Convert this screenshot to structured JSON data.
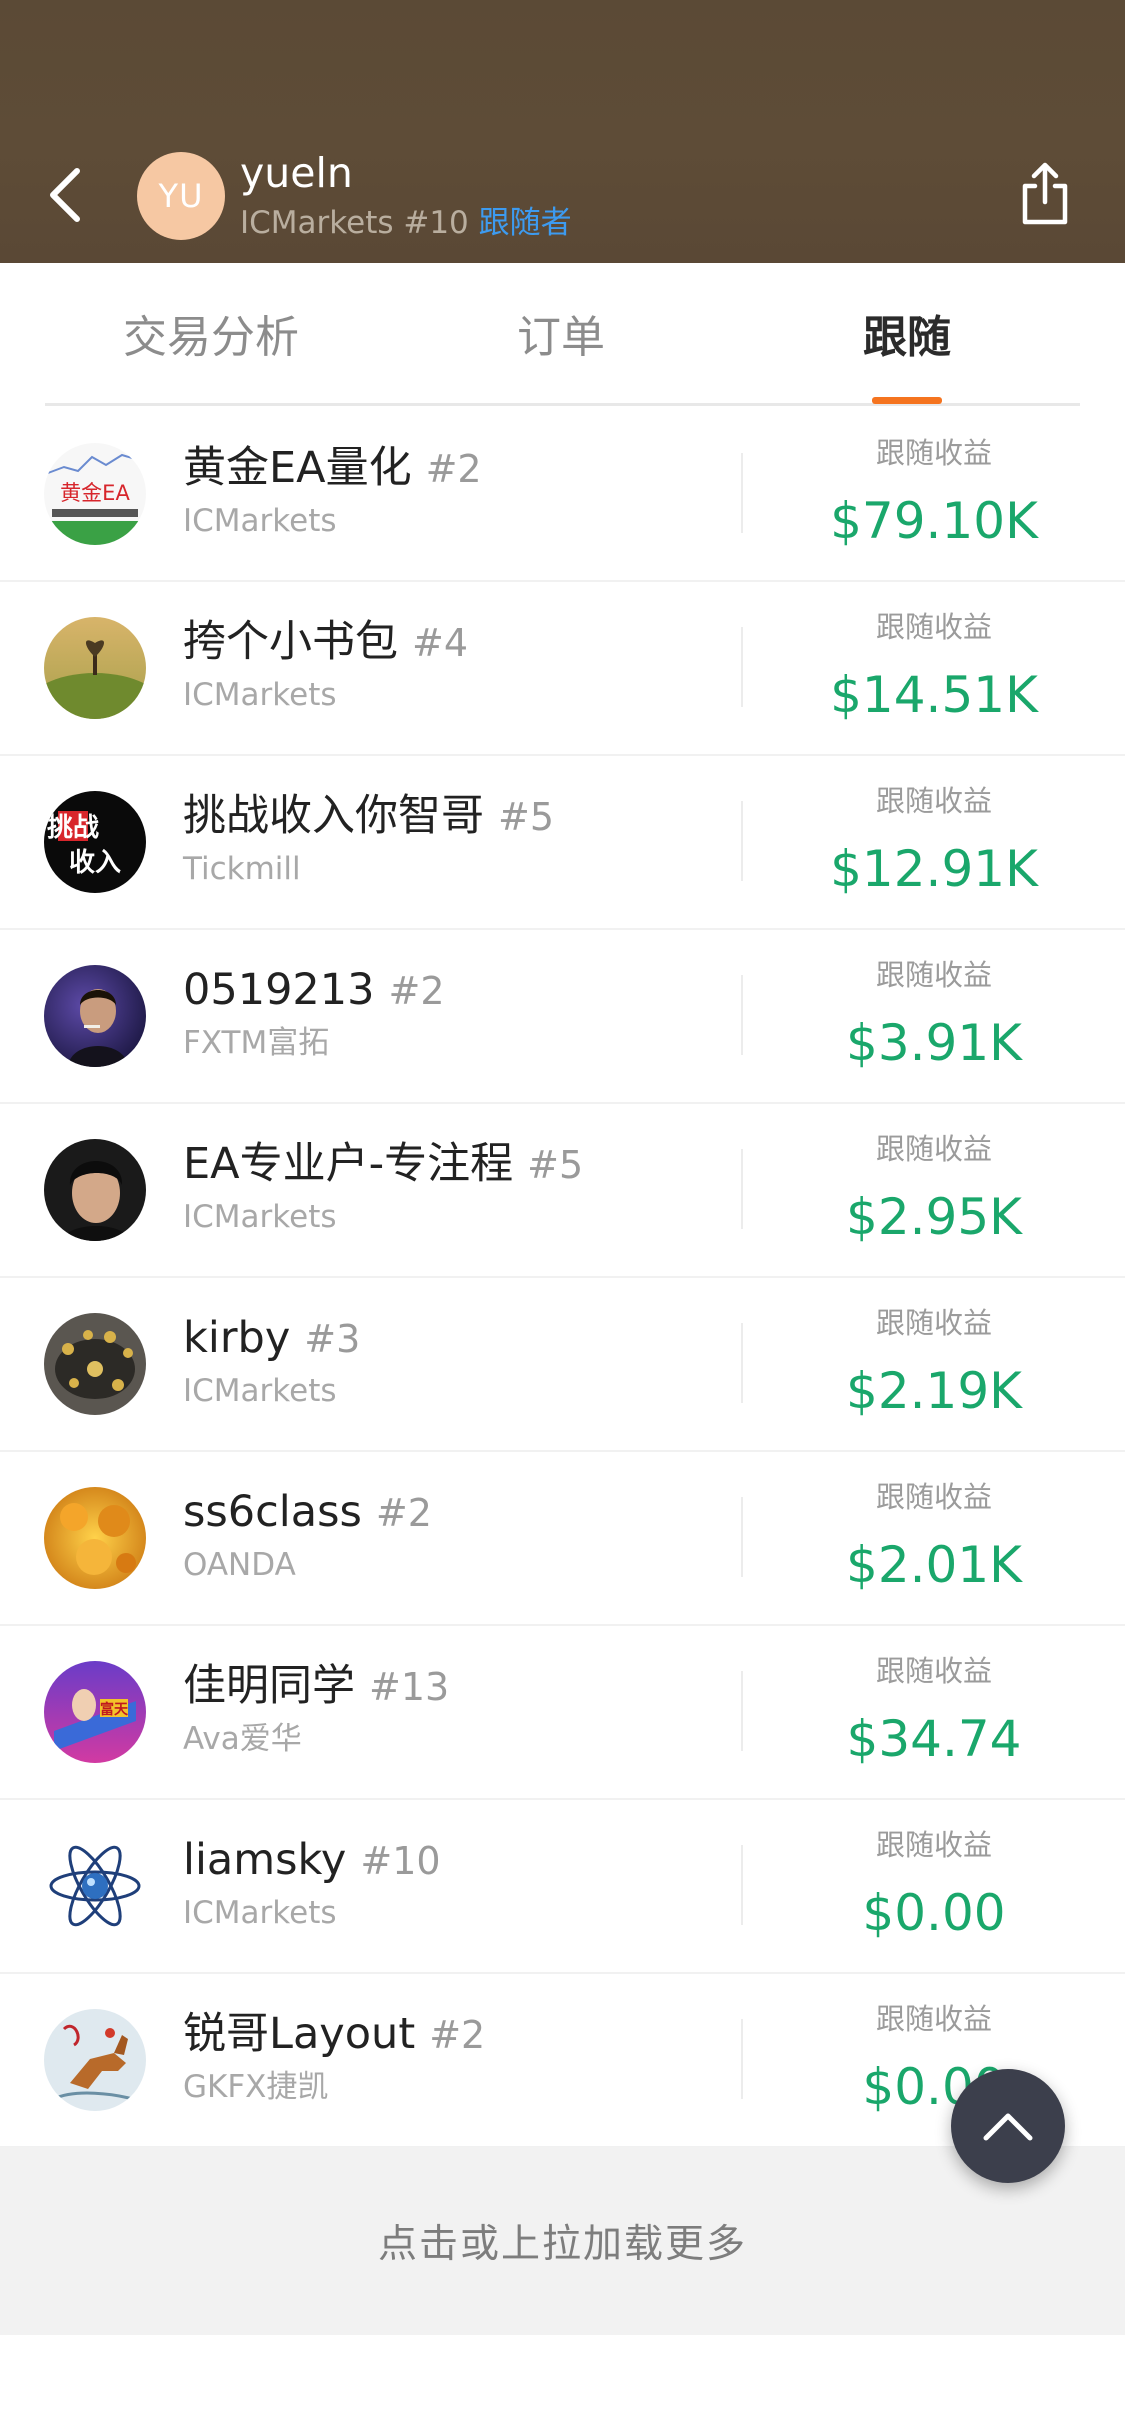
{
  "header": {
    "avatar_initials": "YU",
    "user_name": "yueln",
    "broker_rank": "ICMarkets #10",
    "follower_link": "跟随者",
    "back_icon": "chevron-left-icon",
    "share_icon": "share-icon",
    "avatar_color": "#f6c8a3"
  },
  "tabs": [
    {
      "label": "交易分析",
      "active": false
    },
    {
      "label": "订单",
      "active": false
    },
    {
      "label": "跟随",
      "active": true
    }
  ],
  "colors": {
    "accent": "#f5741f",
    "profit": "#1aa76b",
    "link": "#3d9bf0"
  },
  "followers": [
    {
      "name": "黄金EA量化",
      "rank": "#2",
      "broker": "ICMarkets",
      "label": "跟随收益",
      "value": "$79.10K"
    },
    {
      "name": "挎个小书包",
      "rank": "#4",
      "broker": "ICMarkets",
      "label": "跟随收益",
      "value": "$14.51K"
    },
    {
      "name": "挑战收入你智哥",
      "rank": "#5",
      "broker": "Tickmill",
      "label": "跟随收益",
      "value": "$12.91K"
    },
    {
      "name": "0519213",
      "rank": "#2",
      "broker": "FXTM富拓",
      "label": "跟随收益",
      "value": "$3.91K"
    },
    {
      "name": "EA专业户-专注程",
      "rank": "#5",
      "broker": "ICMarkets",
      "label": "跟随收益",
      "value": "$2.95K"
    },
    {
      "name": "kirby",
      "rank": "#3",
      "broker": "ICMarkets",
      "label": "跟随收益",
      "value": "$2.19K"
    },
    {
      "name": "ss6class",
      "rank": "#2",
      "broker": "OANDA",
      "label": "跟随收益",
      "value": "$2.01K"
    },
    {
      "name": "佳明同学",
      "rank": "#13",
      "broker": "Ava爱华",
      "label": "跟随收益",
      "value": "$34.74"
    },
    {
      "name": "liamsky",
      "rank": "#10",
      "broker": "ICMarkets",
      "label": "跟随收益",
      "value": "$0.00"
    },
    {
      "name": "锐哥Layout",
      "rank": "#2",
      "broker": "GKFX捷凯",
      "label": "跟随收益",
      "value": "$0.00"
    }
  ],
  "avatar_texts": {
    "gold_ea": "黄金EA",
    "challenge_line1": "挑战",
    "challenge_line2": "收入",
    "rich": "富天"
  },
  "load_more": "点击或上拉加载更多",
  "fab_icon": "chevron-up-icon"
}
